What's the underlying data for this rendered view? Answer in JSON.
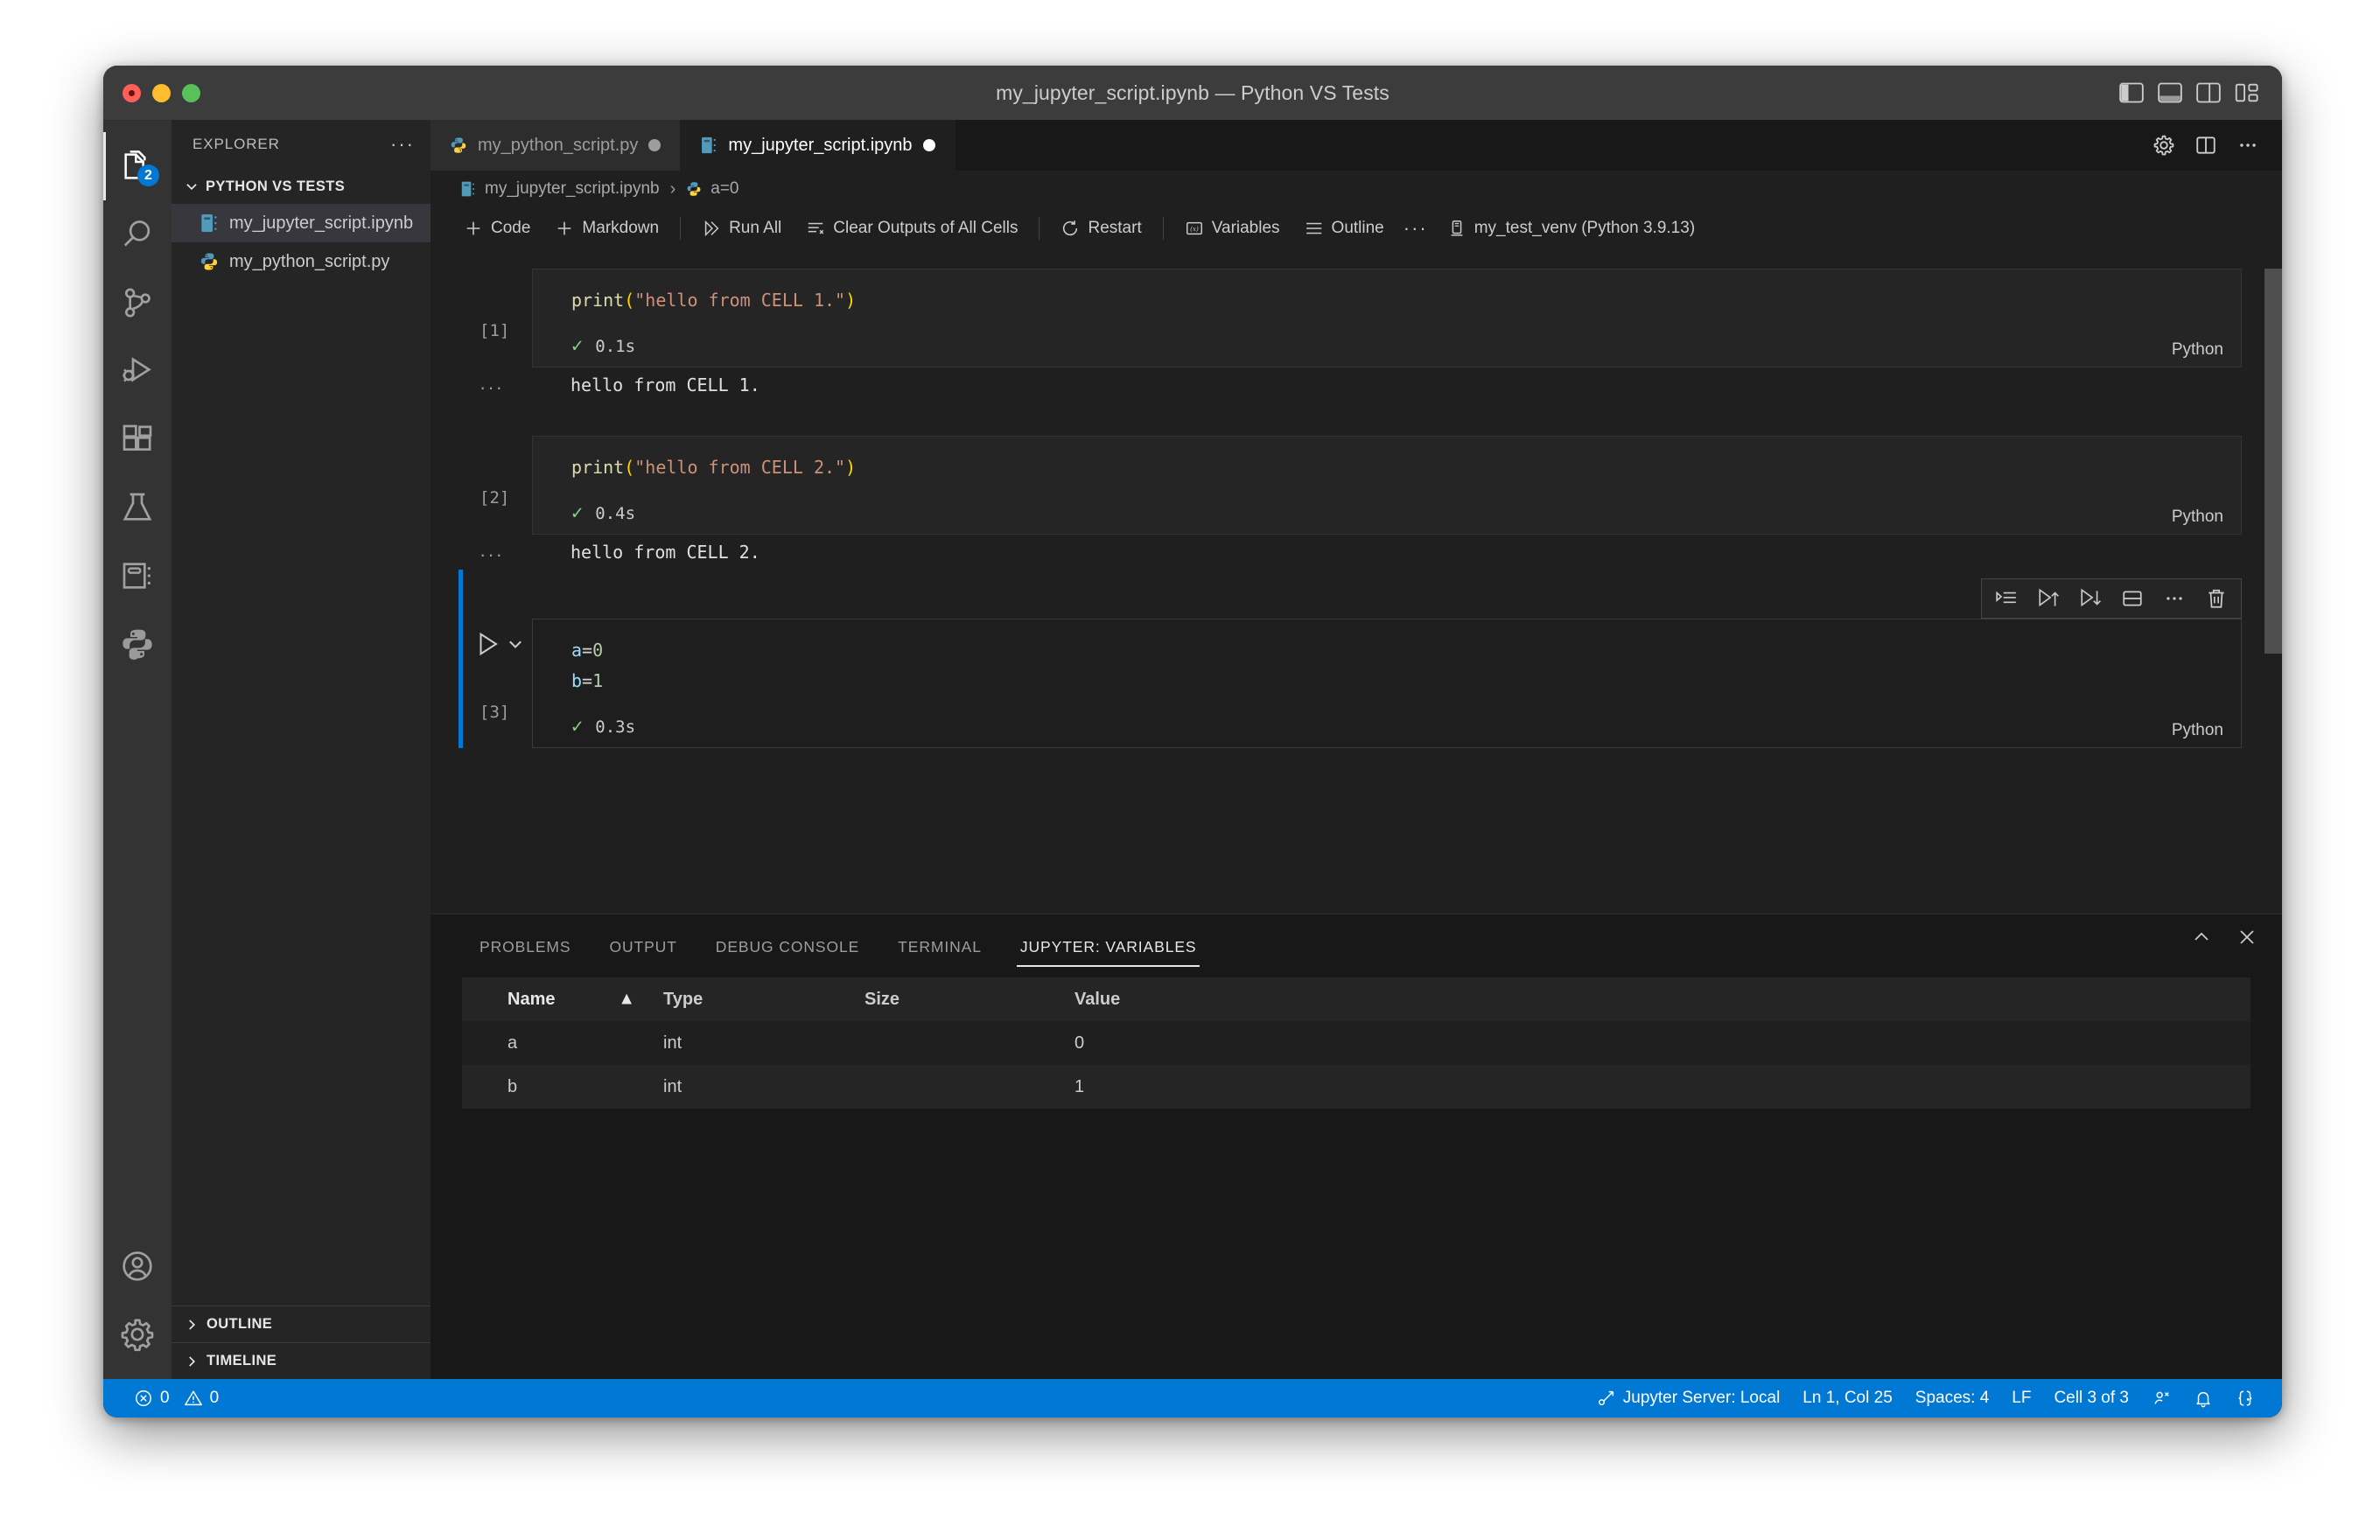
{
  "window": {
    "title": "my_jupyter_script.ipynb — Python VS Tests",
    "traffic": {
      "close": "close-window",
      "minimize": "minimize-window",
      "zoom": "zoom-window"
    },
    "layout_buttons": [
      {
        "name": "toggle-primary-sidebar",
        "label": "Toggle Primary Side Bar"
      },
      {
        "name": "toggle-panel",
        "label": "Toggle Panel"
      },
      {
        "name": "toggle-secondary-sidebar",
        "label": "Toggle Secondary Side Bar"
      },
      {
        "name": "customize-layout",
        "label": "Customize Layout"
      }
    ]
  },
  "activitybar": {
    "items": [
      {
        "name": "explorer",
        "icon": "files-icon",
        "badge": "2",
        "active": true
      },
      {
        "name": "search",
        "icon": "search-icon",
        "badge": "",
        "active": false
      },
      {
        "name": "source-control",
        "icon": "source-control-icon",
        "badge": "",
        "active": false
      },
      {
        "name": "run-and-debug",
        "icon": "run-debug-icon",
        "badge": "",
        "active": false
      },
      {
        "name": "extensions",
        "icon": "extensions-icon",
        "badge": "",
        "active": false
      },
      {
        "name": "testing",
        "icon": "beaker-icon",
        "badge": "",
        "active": false
      },
      {
        "name": "jupyter",
        "icon": "notebook-icon",
        "badge": "",
        "active": false
      },
      {
        "name": "python",
        "icon": "python-icon",
        "badge": "",
        "active": false
      }
    ],
    "bottom": [
      {
        "name": "accounts",
        "icon": "account-icon"
      },
      {
        "name": "manage-settings",
        "icon": "gear-icon"
      }
    ]
  },
  "sidebar": {
    "title": "EXPLORER",
    "more_label": "···",
    "folder": {
      "label": "PYTHON VS TESTS",
      "expanded": true
    },
    "files": [
      {
        "name": "my_jupyter_script.ipynb",
        "icon": "notebook-file-icon",
        "selected": true
      },
      {
        "name": "my_python_script.py",
        "icon": "python-file-icon",
        "selected": false
      }
    ],
    "collapsed_sections": [
      {
        "label": "OUTLINE"
      },
      {
        "label": "TIMELINE"
      }
    ]
  },
  "tabs": [
    {
      "label": "my_python_script.py",
      "icon": "python-file-icon",
      "dirty": true,
      "active": false
    },
    {
      "label": "my_jupyter_script.ipynb",
      "icon": "notebook-file-icon",
      "dirty": true,
      "active": true
    }
  ],
  "tab_actions": [
    {
      "name": "notebook-settings",
      "icon": "gear-icon"
    },
    {
      "name": "split-editor",
      "icon": "split-editor-icon"
    },
    {
      "name": "more-actions",
      "icon": "ellipsis-icon"
    }
  ],
  "breadcrumb": {
    "file": "my_jupyter_script.ipynb",
    "separator": "›",
    "symbol": "a=0"
  },
  "notebook_toolbar": {
    "add_code": "Code",
    "add_markdown": "Markdown",
    "run_all": "Run All",
    "clear_outputs": "Clear Outputs of All Cells",
    "restart": "Restart",
    "variables": "Variables",
    "outline": "Outline",
    "more": "···",
    "kernel": "my_test_venv (Python 3.9.13)"
  },
  "cells": [
    {
      "exec_count": "[1]",
      "code_tokens": [
        {
          "t": "print",
          "c": "k-fn"
        },
        {
          "t": "(",
          "c": "k-paren"
        },
        {
          "t": "\"hello from CELL 1.\"",
          "c": "k-str"
        },
        {
          "t": ")",
          "c": "k-paren"
        }
      ],
      "code_plain": "print(\"hello from CELL 1.\")",
      "status_time": "0.1s",
      "status_check": "✓",
      "language": "Python",
      "output": "hello from CELL 1.",
      "focused": false
    },
    {
      "exec_count": "[2]",
      "code_tokens": [
        {
          "t": "print",
          "c": "k-fn"
        },
        {
          "t": "(",
          "c": "k-paren"
        },
        {
          "t": "\"hello from CELL 2.\"",
          "c": "k-str"
        },
        {
          "t": ")",
          "c": "k-paren"
        }
      ],
      "code_plain": "print(\"hello from CELL 2.\")",
      "status_time": "0.4s",
      "status_check": "✓",
      "language": "Python",
      "output": "hello from CELL 2.",
      "focused": false
    },
    {
      "exec_count": "[3]",
      "code_line1": [
        {
          "t": "a",
          "c": "k-var"
        },
        {
          "t": "=",
          "c": "k-op"
        },
        {
          "t": "0",
          "c": "k-num"
        }
      ],
      "code_line2": [
        {
          "t": "b",
          "c": "k-var"
        },
        {
          "t": "=",
          "c": "k-op"
        },
        {
          "t": "1",
          "c": "k-num"
        }
      ],
      "code_plain": "a=0\nb=1",
      "status_time": "0.3s",
      "status_check": "✓",
      "language": "Python",
      "output": "",
      "focused": true
    }
  ],
  "cell_toolbar": [
    {
      "name": "run-by-line-icon",
      "label": "Run by Line"
    },
    {
      "name": "run-above-icon",
      "label": "Execute Above Cells"
    },
    {
      "name": "run-below-icon",
      "label": "Execute Cell and Below"
    },
    {
      "name": "split-cell-icon",
      "label": "Split Cell"
    },
    {
      "name": "more-actions-icon",
      "label": "···"
    },
    {
      "name": "delete-cell-icon",
      "label": "Delete Cell"
    }
  ],
  "panel": {
    "tabs": [
      {
        "label": "PROBLEMS",
        "active": false
      },
      {
        "label": "OUTPUT",
        "active": false
      },
      {
        "label": "DEBUG CONSOLE",
        "active": false
      },
      {
        "label": "TERMINAL",
        "active": false
      },
      {
        "label": "JUPYTER: VARIABLES",
        "active": true
      }
    ],
    "actions": [
      {
        "name": "collapse-panel-icon",
        "label": "^"
      },
      {
        "name": "close-panel-icon",
        "label": "×"
      }
    ],
    "variables_table": {
      "columns": [
        "Name",
        "Type",
        "Size",
        "Value"
      ],
      "sort_column": "Name",
      "sort_direction": "ascending",
      "sort_glyph": "▲",
      "rows": [
        {
          "name": "a",
          "type": "int",
          "size": "",
          "value": "0"
        },
        {
          "name": "b",
          "type": "int",
          "size": "",
          "value": "1"
        }
      ]
    }
  },
  "statusbar": {
    "errors": "0",
    "warnings": "0",
    "jupyter_server": "Jupyter Server: Local",
    "cursor": "Ln 1, Col 25",
    "spaces": "Spaces: 4",
    "eol": "LF",
    "cell_indicator": "Cell 3 of 3",
    "right_icons": [
      {
        "name": "live-share-icon"
      },
      {
        "name": "bell-icon"
      },
      {
        "name": "copilot-icon"
      }
    ]
  },
  "colors": {
    "accent": "#0078d4",
    "window_chrome": "#3c3c3c",
    "activitybar": "#333333",
    "sidebar": "#252526",
    "editor": "#1f1f1f",
    "panel": "#181818",
    "success": "#89d185"
  }
}
